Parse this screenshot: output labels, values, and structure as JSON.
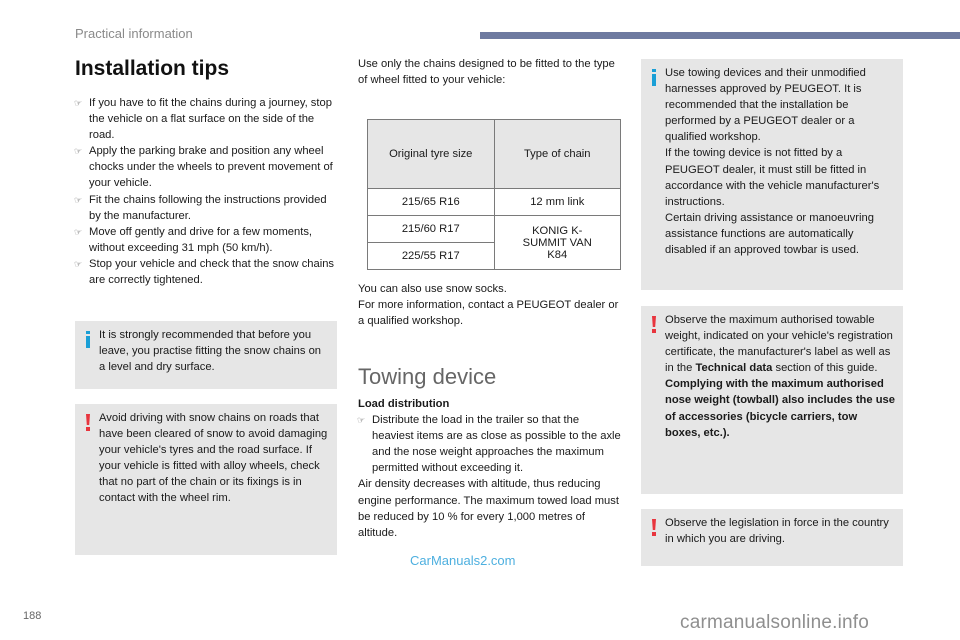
{
  "header": {
    "section_title": "Practical information"
  },
  "installation": {
    "title": "Installation tips",
    "bullets": [
      "If you have to fit the chains during a journey, stop the vehicle on a flat surface on the side of the road.",
      "Apply the parking brake and position any wheel chocks under the wheels to prevent movement of your vehicle.",
      "Fit the chains following the instructions provided by the manufacturer.",
      "Move off gently and drive for a few moments, without exceeding 31 mph (50 km/h).",
      "Stop your vehicle and check that the snow chains are correctly tightened."
    ],
    "info_box": "It is strongly recommended that before you leave, you practise fitting the snow chains on a level and dry surface.",
    "warning_box": "Avoid driving with snow chains on roads that have been cleared of snow to avoid damaging your vehicle's tyres and the road surface. If your vehicle is fitted with alloy wheels, check that no part of the chain or its fixings is in contact with the wheel rim."
  },
  "chains": {
    "intro": "Use only the chains designed to be fitted to the type of wheel fitted to your vehicle:",
    "table": {
      "headers": [
        "Original tyre size",
        "Type of chain"
      ],
      "rows": [
        {
          "tyre": "215/65 R16",
          "chain": "12 mm link"
        },
        {
          "tyre": "215/60 R17",
          "chain": "KONIG K-SUMMIT VAN K84"
        },
        {
          "tyre": "225/55 R17",
          "chain": "KONIG K-SUMMIT VAN K84"
        }
      ]
    },
    "after_table_1": "You can also use snow socks.",
    "after_table_2": "For more information, contact a PEUGEOT dealer or a qualified workshop."
  },
  "towing": {
    "title": "Towing device",
    "subheading": "Load distribution",
    "bullet": "Distribute the load in the trailer so that the heaviest items are as close as possible to the axle and the nose weight approaches the maximum permitted without exceeding it.",
    "altitude_text": "Air density decreases with altitude, thus reducing engine performance. The maximum towed load must be reduced by 10 % for every 1,000 metres of altitude.",
    "info_box": {
      "p1": "Use towing devices and their unmodified harnesses approved by PEUGEOT. It is recommended that the installation be performed by a PEUGEOT dealer or a qualified workshop.",
      "p2": "If the towing device is not fitted by a PEUGEOT dealer, it must still be fitted in accordance with the vehicle manufacturer's instructions.",
      "p3": "Certain driving assistance or manoeuvring assistance functions are automatically disabled if an approved towbar is used."
    },
    "warning_box_1": {
      "text_before": "Observe the maximum authorised towable weight, indicated on your vehicle's registration certificate, the manufacturer's label as well as in the ",
      "bold_ref": "Technical data",
      "text_after": " section of this guide.",
      "bold_paragraph": "Complying with the maximum authorised nose weight (towball) also includes the use of accessories (bicycle carriers, tow boxes, etc.)."
    },
    "warning_box_2": "Observe the legislation in force in the country in which you are driving."
  },
  "footer": {
    "page_number": "188",
    "watermark_overlay": "CarManuals2.com",
    "watermark_site": "carmanualsonline.info"
  },
  "icons": {
    "bullet": "☞"
  },
  "colors": {
    "header_bar": "#6e7aa0",
    "info_icon": "#1a9fd6",
    "warning_icon": "#e8353e",
    "box_background": "#e6e6e6"
  }
}
